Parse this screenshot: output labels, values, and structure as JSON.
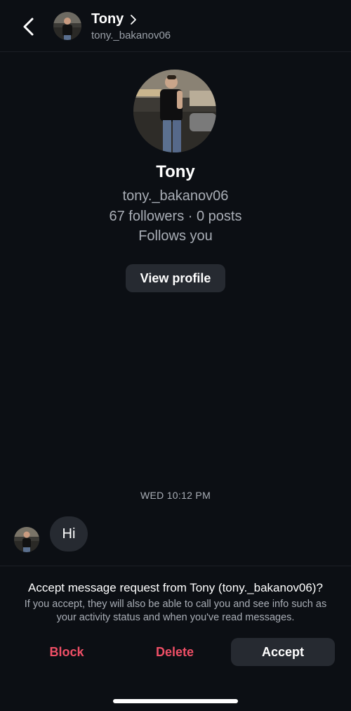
{
  "header": {
    "name": "Tony",
    "username": "tony._bakanov06"
  },
  "profile": {
    "name": "Tony",
    "username": "tony._bakanov06",
    "stats": "67 followers · 0 posts",
    "follows": "Follows you",
    "view_profile_label": "View profile"
  },
  "conversation": {
    "timestamp": "WED 10:12 PM",
    "messages": [
      {
        "text": "Hi"
      }
    ]
  },
  "request": {
    "title": "Accept message request from Tony (tony._bakanov06)?",
    "subtitle": "If you accept, they will also be able to call you and see info such as your activity status and when you've read messages.",
    "block_label": "Block",
    "delete_label": "Delete",
    "accept_label": "Accept"
  },
  "colors": {
    "background": "#0c0f14",
    "button_bg": "#262a31",
    "danger": "#ef4f66",
    "secondary_text": "#a9aeb6"
  }
}
